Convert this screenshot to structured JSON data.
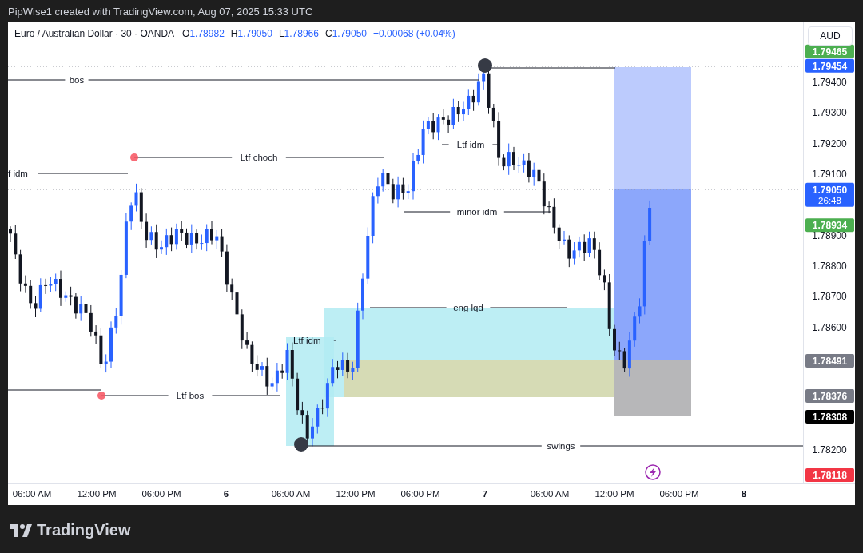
{
  "header": {
    "caption": "PipWise1 created with TradingView.com, Aug 07, 2025 15:33 UTC"
  },
  "legend": {
    "symbol": "Euro / Australian Dollar · 30 · OANDA",
    "ohlc": [
      {
        "label": "O",
        "value": "1.78982"
      },
      {
        "label": "H",
        "value": "1.79050"
      },
      {
        "label": "L",
        "value": "1.78966"
      },
      {
        "label": "C",
        "value": "1.79050"
      }
    ],
    "change": "+0.00068 (+0.04%)"
  },
  "currency_button": "AUD",
  "price_ticks": [
    "1.79400",
    "1.79300",
    "1.79200",
    "1.79100",
    "1.78900",
    "1.78800",
    "1.78700",
    "1.78600",
    "1.78200"
  ],
  "price_badges": [
    {
      "text": "1.79465",
      "color": "#4caf50"
    },
    {
      "text": "1.79454",
      "color": "#2962ff"
    },
    {
      "text": "1.79050",
      "countdown": "26:48",
      "color": "#2962ff"
    },
    {
      "text": "1.78934",
      "color": "#4caf50"
    },
    {
      "text": "1.78491",
      "color": "#787b86"
    },
    {
      "text": "1.78376",
      "color": "#787b86"
    },
    {
      "text": "1.78308",
      "color": "#000000"
    },
    {
      "text": "1.78118",
      "color": "#f23645"
    }
  ],
  "annotations": [
    "bos",
    "f idm",
    "Ltf choch",
    "Ltf idm",
    "minor idm",
    "eng lqd",
    "Ltf idm",
    "Ltf bos",
    "swings"
  ],
  "time_ticks": [
    {
      "text": "06:00 AM",
      "kind": "time"
    },
    {
      "text": "12:00 PM",
      "kind": "time"
    },
    {
      "text": "06:00 PM",
      "kind": "time"
    },
    {
      "text": "6",
      "kind": "day"
    },
    {
      "text": "06:00 AM",
      "kind": "time"
    },
    {
      "text": "12:00 PM",
      "kind": "time"
    },
    {
      "text": "06:00 PM",
      "kind": "time"
    },
    {
      "text": "7",
      "kind": "day"
    },
    {
      "text": "06:00 AM",
      "kind": "time"
    },
    {
      "text": "12:00 PM",
      "kind": "time"
    },
    {
      "text": "06:00 PM",
      "kind": "time"
    },
    {
      "text": "8",
      "kind": "day"
    }
  ],
  "logo": "TradingView"
}
